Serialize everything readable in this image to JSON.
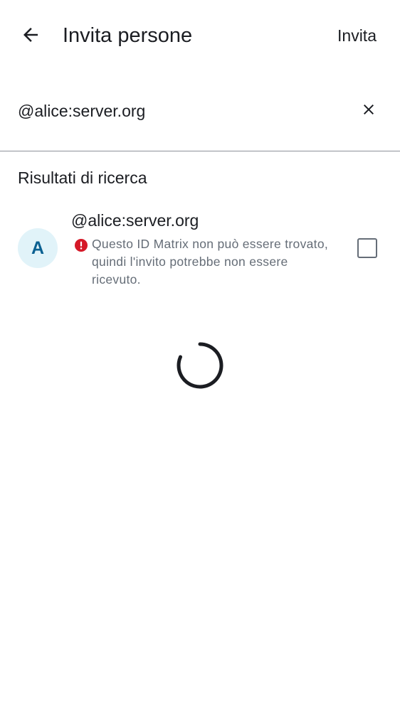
{
  "header": {
    "title": "Invita persone",
    "action_label": "Invita",
    "back_icon": "arrow-back-icon"
  },
  "search": {
    "value": "@alice:server.org",
    "clear_icon": "close-icon"
  },
  "results": {
    "section_title": "Risultati di ricerca",
    "items": [
      {
        "avatar_letter": "A",
        "name": "@alice:server.org",
        "warning_icon": "error-icon",
        "warning": "Questo ID Matrix non può essere trovato, quindi l'invito potrebbe non essere ricevuto.",
        "checked": false
      }
    ]
  },
  "loading": {
    "icon": "loading-spinner-icon"
  },
  "colors": {
    "text_primary": "#1b1d22",
    "text_secondary": "#656d77",
    "avatar_bg": "#e1f3f9",
    "avatar_fg": "#0a6091",
    "error": "#d51928",
    "divider": "#8d919a"
  }
}
